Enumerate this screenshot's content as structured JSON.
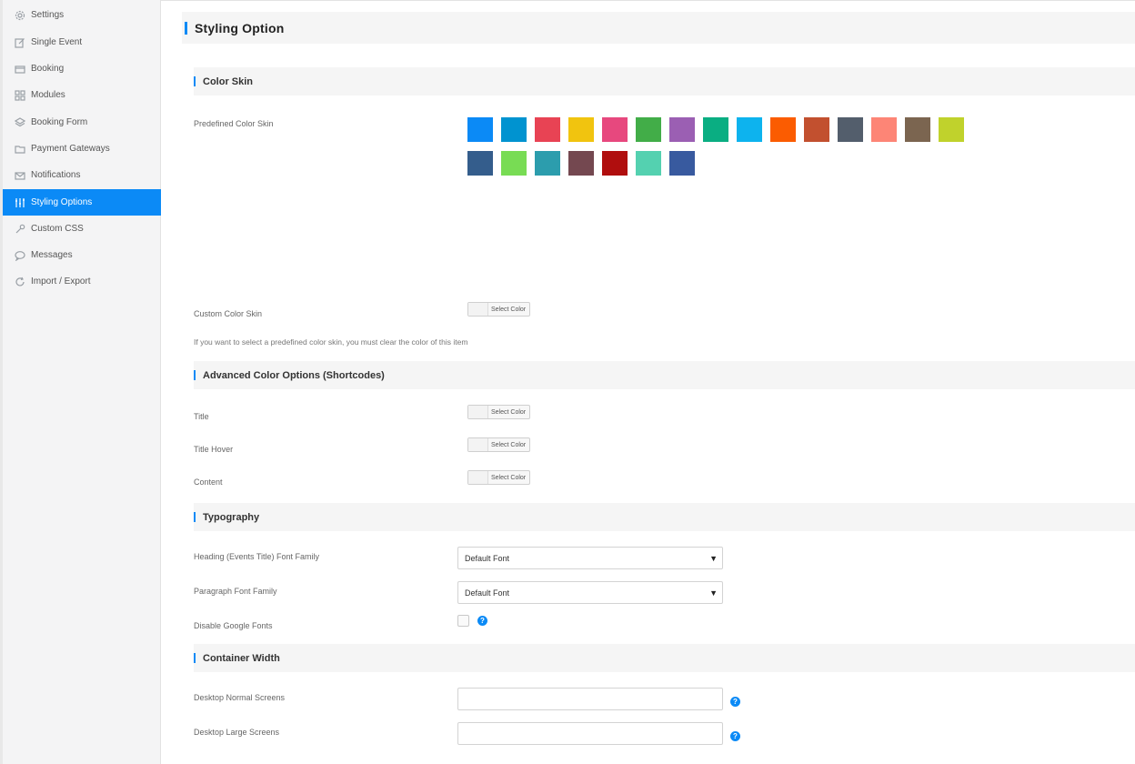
{
  "sidebar": {
    "items": [
      {
        "label": "Settings",
        "icon": "gear-icon"
      },
      {
        "label": "Single Event",
        "icon": "edit-icon"
      },
      {
        "label": "Booking",
        "icon": "card-icon"
      },
      {
        "label": "Modules",
        "icon": "grid-icon"
      },
      {
        "label": "Booking Form",
        "icon": "layers-icon"
      },
      {
        "label": "Payment Gateways",
        "icon": "folder-icon"
      },
      {
        "label": "Notifications",
        "icon": "envelope-icon"
      },
      {
        "label": "Styling Options",
        "icon": "sliders-icon",
        "active": true
      },
      {
        "label": "Custom CSS",
        "icon": "wrench-icon"
      },
      {
        "label": "Messages",
        "icon": "chat-bubble-icon"
      },
      {
        "label": "Import / Export",
        "icon": "refresh-icon"
      }
    ]
  },
  "page": {
    "title": "Styling Option"
  },
  "color_skin": {
    "heading": "Color Skin",
    "predefined_label": "Predefined Color Skin",
    "swatches_row1": [
      "#0b8af6",
      "#0093d0",
      "#e84354",
      "#f1c40f",
      "#e7487e",
      "#42ad48",
      "#9b5fb3",
      "#0aae82",
      "#0db3ee",
      "#fb5c01",
      "#c2502f",
      "#535e6c",
      "#fd8576",
      "#7b6550",
      "#c0d22c"
    ],
    "swatches_row2": [
      "#345d8c",
      "#78dc54",
      "#2c9dad",
      "#744850",
      "#b00e0e",
      "#54d1b0",
      "#385a9f"
    ],
    "custom_label": "Custom Color Skin",
    "select_color_text": "Select Color",
    "note": "If you want to select a predefined color skin, you must clear the color of this item"
  },
  "advanced": {
    "heading": "Advanced Color Options (Shortcodes)",
    "title_label": "Title",
    "title_hover_label": "Title Hover",
    "content_label": "Content",
    "select_color_text": "Select Color"
  },
  "typography": {
    "heading": "Typography",
    "heading_font_label": "Heading (Events Title) Font Family",
    "heading_font_value": "Default Font",
    "paragraph_font_label": "Paragraph Font Family",
    "paragraph_font_value": "Default Font",
    "disable_google_label": "Disable Google Fonts",
    "help_symbol": "?"
  },
  "container": {
    "heading": "Container Width",
    "normal_label": "Desktop Normal Screens",
    "large_label": "Desktop Large Screens",
    "help_symbol": "?",
    "normal_value": "",
    "large_value": ""
  },
  "colors": {
    "accent": "#0b8af6",
    "sidebar_bg": "#f4f4f5",
    "section_bg": "#f5f5f5"
  }
}
